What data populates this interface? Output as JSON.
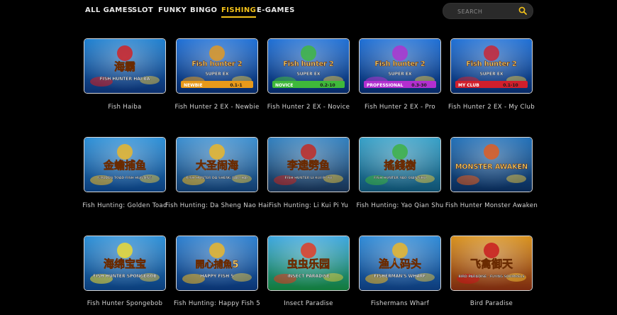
{
  "nav": {
    "tabs": [
      {
        "label": "ALL GAMES",
        "active": false
      },
      {
        "label": "SLOT",
        "active": false
      },
      {
        "label": "FUNKY",
        "active": false
      },
      {
        "label": "BINGO",
        "active": false
      },
      {
        "label": "FISHING",
        "active": true
      },
      {
        "label": "E-GAMES",
        "active": false
      }
    ],
    "search_placeholder": "SEARCH",
    "accent_color": "#f3c21a"
  },
  "games": [
    {
      "title": "Fish Haiba",
      "art_text": "海霸",
      "art_sub": "FISH HUNTER HAI BA",
      "bg": "#1c7fd0",
      "bg2": "#0b2f6e",
      "accent": "#d81b1b"
    },
    {
      "title": "Fish Hunter 2 EX - Newbie",
      "art_text": "Fish hunter 2",
      "art_sub": "SUPER EX",
      "badge": "NEWBIE",
      "badge_val": "0.1-1",
      "bg": "#1d6fd6",
      "bg2": "#072a66",
      "accent": "#e89a1a"
    },
    {
      "title": "Fish Hunter 2 EX - Novice",
      "art_text": "Fish hunter 2",
      "art_sub": "SUPER EX",
      "badge": "NOVICE",
      "badge_val": "0.2-10",
      "bg": "#1d6fd6",
      "bg2": "#072a66",
      "accent": "#3fb93a"
    },
    {
      "title": "Fish Hunter 2 EX - Pro",
      "art_text": "Fish hunter 2",
      "art_sub": "SUPER EX",
      "badge": "PROFESSIONAL",
      "badge_val": "0.3-30",
      "bg": "#1d6fd6",
      "bg2": "#072a66",
      "accent": "#b32fd0"
    },
    {
      "title": "Fish Hunter 2 EX - My Club",
      "art_text": "Fish hunter 2",
      "art_sub": "SUPER EX",
      "badge": "MY CLUB",
      "badge_val": "0.1-10",
      "bg": "#1d6fd6",
      "bg2": "#072a66",
      "accent": "#d11f2c"
    },
    {
      "title": "Fish Hunting: Golden Toad",
      "art_text": "金蟾捕鱼",
      "art_sub": "GOLDEN TOAD FISH HUNTING",
      "bg": "#2a8fd8",
      "bg2": "#0b3d7a",
      "accent": "#f2b820"
    },
    {
      "title": "Fish Hunting: Da Sheng Nao Hai",
      "art_text": "大圣闹海",
      "art_sub": "FISH HUNTER DA SHENG NAO HAI",
      "bg": "#3a8ed0",
      "bg2": "#113b6b",
      "accent": "#f2b820"
    },
    {
      "title": "Fish Hunting: Li Kui Pi Yu",
      "art_text": "李逵劈鱼",
      "art_sub": "FISH HUNTER LI KUI PI YU",
      "bg": "#2f7fbf",
      "bg2": "#173050",
      "accent": "#c8241c"
    },
    {
      "title": "Fish Hunting: Yao Qian Shu",
      "art_text": "搖錢樹",
      "art_sub": "FISH HUNTER YAO QIAN SHU",
      "bg": "#35a0c8",
      "bg2": "#0f4f6e",
      "accent": "#3cb13c"
    },
    {
      "title": "Fish Hunter Monster Awaken",
      "art_text": "MONSTER AWAKEN",
      "art_sub": "",
      "bg": "#1f6fb8",
      "bg2": "#0a2a55",
      "accent": "#e85a18"
    },
    {
      "title": "Fish Hunter Spongebob",
      "art_text": "海绵宝宝",
      "art_sub": "FISH HUNTER SPONGEBOB",
      "bg": "#2a8fd8",
      "bg2": "#0b3d7a",
      "accent": "#f4dd2a"
    },
    {
      "title": "Fish Hunting: Happy Fish 5",
      "art_text": "開心捕魚5",
      "art_sub": "HAPPY FISH 5",
      "bg": "#2a7fd0",
      "bg2": "#0a3370",
      "accent": "#f2b820"
    },
    {
      "title": "Insect Paradise",
      "art_text": "虫虫乐园",
      "art_sub": "INSECT PARADISE",
      "bg": "#3aa6e0",
      "bg2": "#127a3a",
      "accent": "#e8341c"
    },
    {
      "title": "Fishermans Wharf",
      "art_text": "渔人码头",
      "art_sub": "FISHERMAN'S WHARF",
      "bg": "#2d8ad8",
      "bg2": "#0d3a78",
      "accent": "#f2b820"
    },
    {
      "title": "Bird Paradise",
      "art_text": "飞禽御天",
      "art_sub": "BIRD PARADISE · FLYING SQUIRRELS",
      "bg": "#d8901a",
      "bg2": "#7a2a10",
      "accent": "#c8141c"
    }
  ]
}
